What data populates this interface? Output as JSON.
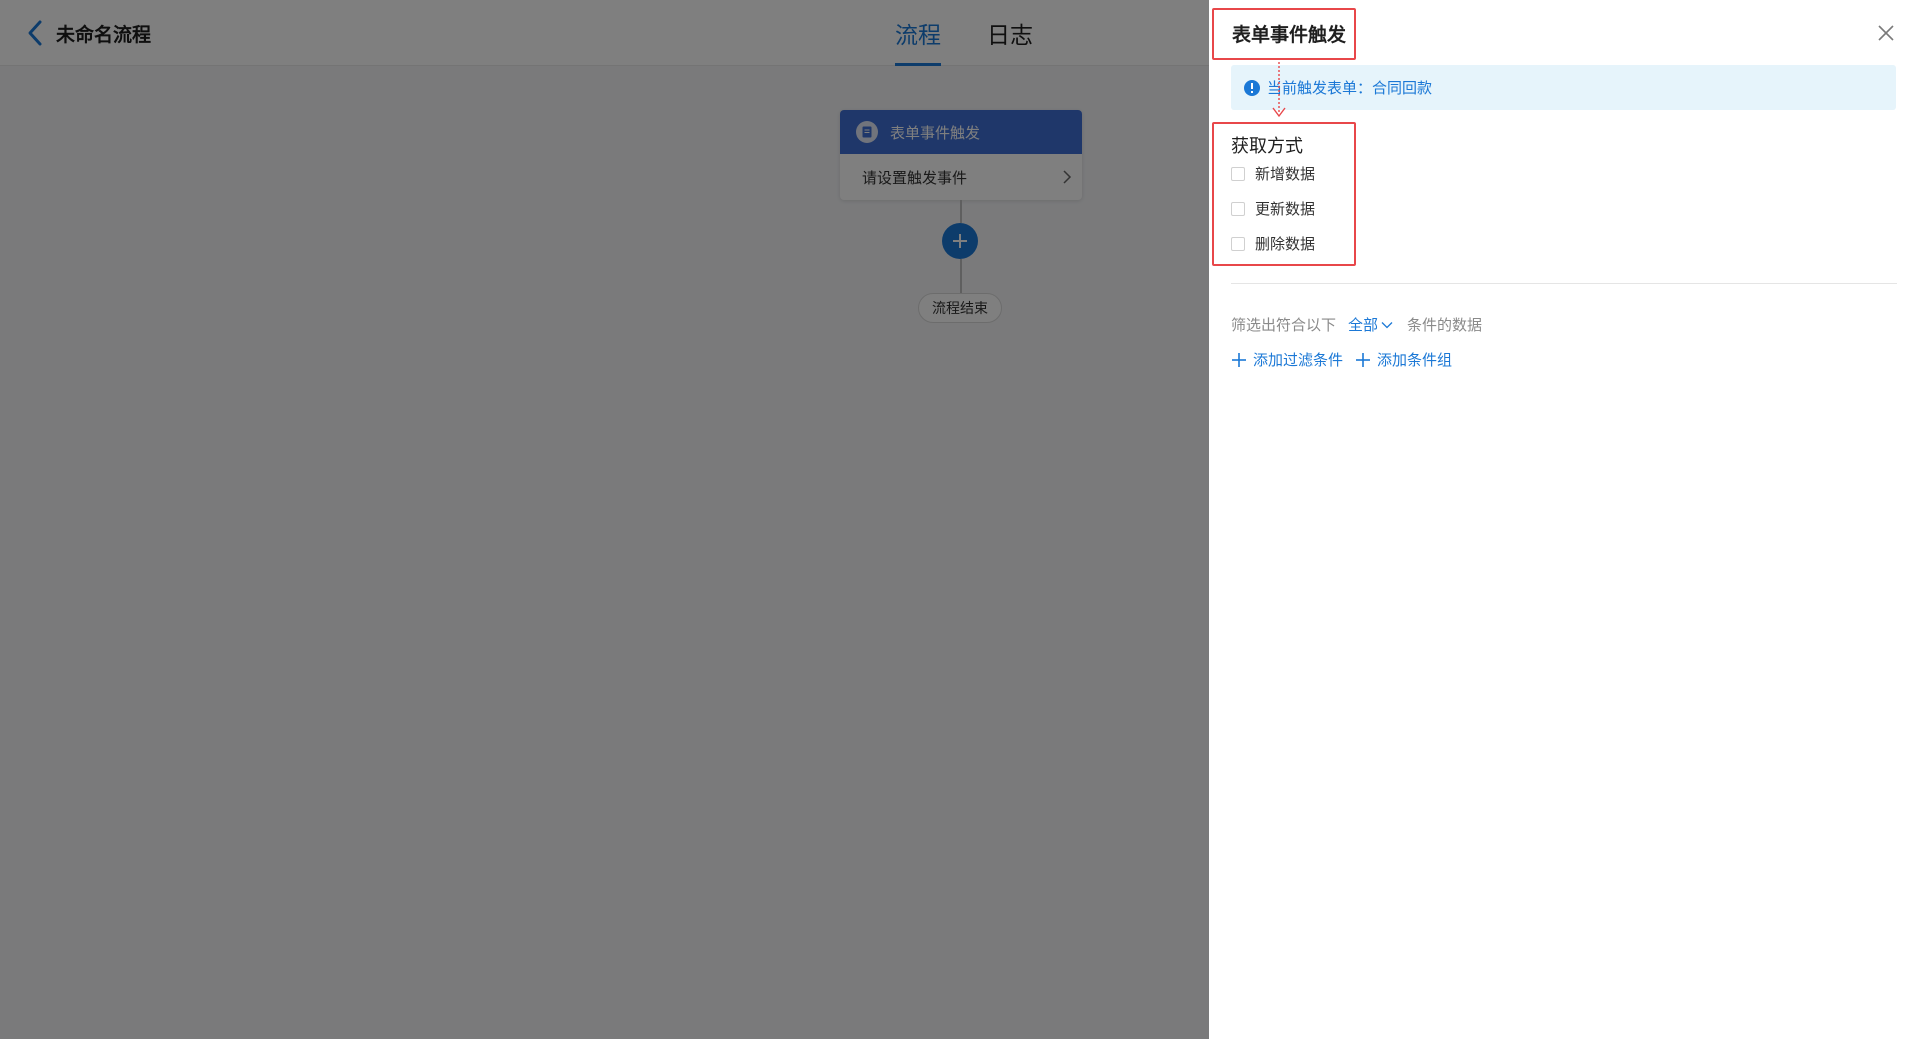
{
  "header": {
    "title": "未命名流程",
    "tabs": [
      {
        "label": "流程",
        "active": true
      },
      {
        "label": "日志",
        "active": false
      }
    ]
  },
  "flow": {
    "trigger_node": {
      "title": "表单事件触发",
      "subtitle": "请设置触发事件"
    },
    "add_icon": "plus-icon",
    "end_label": "流程结束"
  },
  "drawer": {
    "title": "表单事件触发",
    "info": {
      "label": "当前触发表单：",
      "form_name": "合同回款"
    },
    "fetch_method": {
      "title": "获取方式",
      "options": [
        {
          "label": "新增数据",
          "checked": false
        },
        {
          "label": "更新数据",
          "checked": false
        },
        {
          "label": "删除数据",
          "checked": false
        }
      ]
    },
    "filter": {
      "prefix": "筛选出符合以下",
      "select_value": "全部",
      "suffix": "条件的数据",
      "add_condition": "添加过滤条件",
      "add_group": "添加条件组"
    }
  },
  "colors": {
    "accent": "#1b78d6",
    "node_header": "#3f6fd4",
    "annotation": "#e8474a",
    "info_bg": "#e6f4fb"
  }
}
